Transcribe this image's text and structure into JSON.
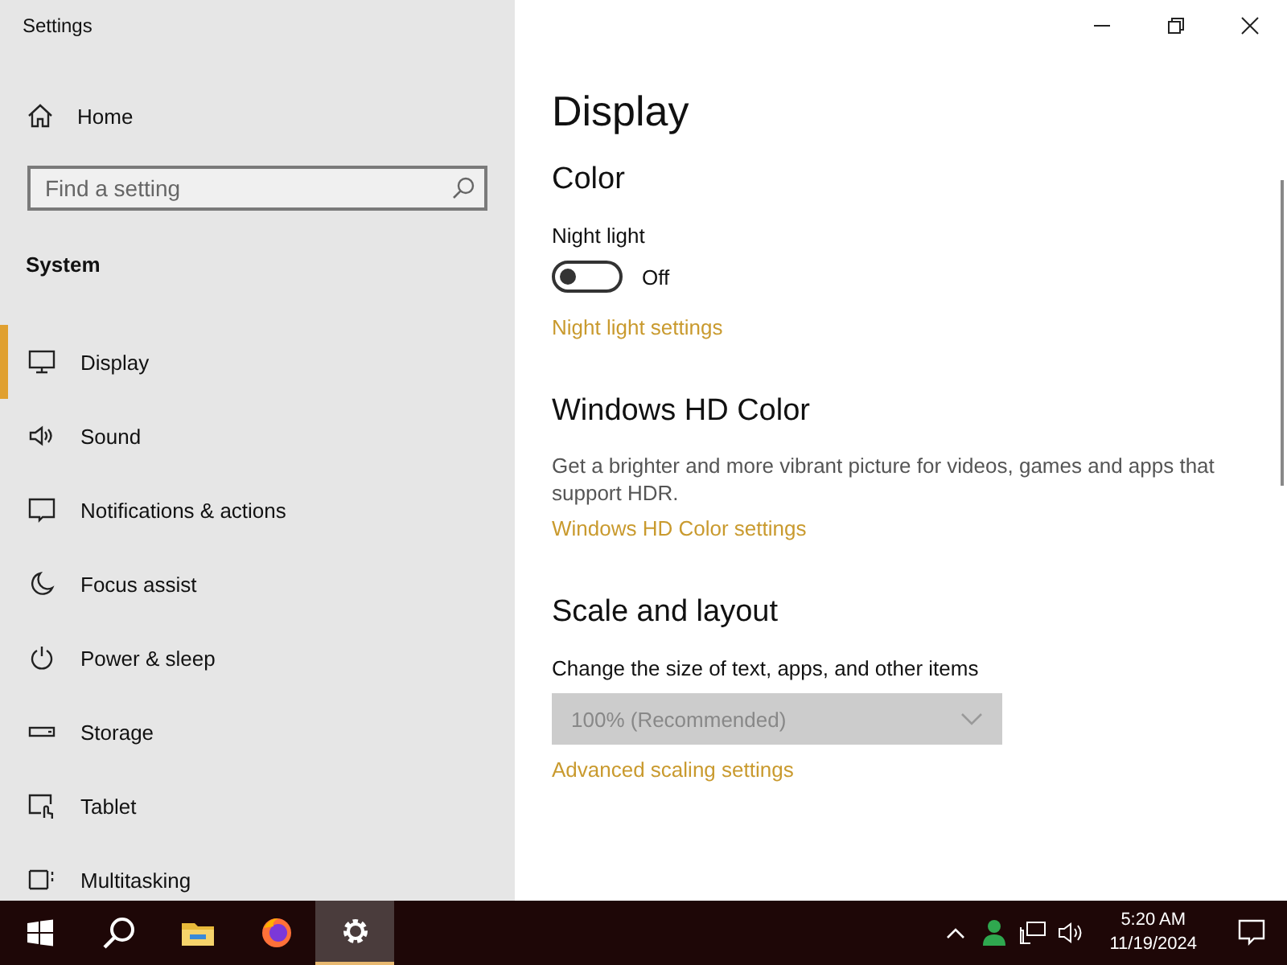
{
  "window": {
    "title": "Settings"
  },
  "sidebar": {
    "home": "Home",
    "search": {
      "placeholder": "Find a setting"
    },
    "section": "System",
    "items": [
      {
        "label": "Display",
        "selected": true
      },
      {
        "label": "Sound",
        "selected": false
      },
      {
        "label": "Notifications & actions",
        "selected": false
      },
      {
        "label": "Focus assist",
        "selected": false
      },
      {
        "label": "Power & sleep",
        "selected": false
      },
      {
        "label": "Storage",
        "selected": false
      },
      {
        "label": "Tablet",
        "selected": false
      },
      {
        "label": "Multitasking",
        "selected": false
      }
    ]
  },
  "content": {
    "heading": "Display",
    "sections": [
      {
        "title": "Color",
        "blocks": [
          {
            "kind": "toggle",
            "label": "Night light",
            "on": false,
            "state": "Off"
          },
          {
            "kind": "link",
            "text": "Night light settings"
          }
        ]
      },
      {
        "title": "Windows HD Color",
        "blocks": [
          {
            "kind": "text",
            "text": "Get a brighter and more vibrant picture for videos, games and apps that support HDR."
          },
          {
            "kind": "link",
            "text": "Windows HD Color settings"
          }
        ]
      },
      {
        "title": "Scale and layout",
        "blocks": [
          {
            "kind": "dropdown",
            "label": "Change the size of text, apps, and other items",
            "value": "100% (Recommended)",
            "disabled": true
          },
          {
            "kind": "link",
            "text": "Advanced scaling settings"
          }
        ]
      }
    ]
  },
  "taskbar": {
    "apps": [
      {
        "selected": false
      },
      {
        "selected": false
      },
      {
        "selected": true
      }
    ],
    "time": "5:20 AM",
    "date": "11/19/2024"
  }
}
